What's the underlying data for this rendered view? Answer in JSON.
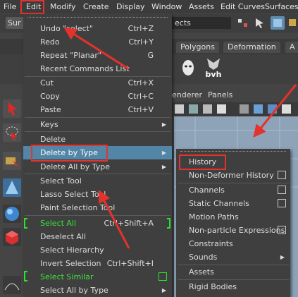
{
  "menubar": {
    "items": [
      "File",
      "Edit",
      "Modify",
      "Create",
      "Display",
      "Window",
      "Assets",
      "Edit Curves",
      "Surfaces"
    ]
  },
  "background": {
    "workspace_field": "Sur",
    "objects_field": "ects",
    "shelf_tabs": [
      "Polygons",
      "Deformation",
      "A"
    ],
    "bvh_label": "bvh",
    "panel_menu": [
      "enderer",
      "Panels"
    ]
  },
  "edit_menu": {
    "items": [
      {
        "label": "Undo \"select\"",
        "shortcut": "Ctrl+Z"
      },
      {
        "label": "Redo",
        "shortcut": "Ctrl+Y"
      },
      {
        "label": "Repeat \"Planar\"",
        "shortcut": "G"
      },
      {
        "label": "Recent Commands List",
        "shortcut": ""
      },
      {
        "label": "Cut",
        "shortcut": "Ctrl+X"
      },
      {
        "label": "Copy",
        "shortcut": "Ctrl+C"
      },
      {
        "label": "Paste",
        "shortcut": "Ctrl+V"
      },
      {
        "label": "Keys",
        "shortcut": ""
      },
      {
        "label": "Delete",
        "shortcut": ""
      },
      {
        "label": "Delete by Type",
        "shortcut": ""
      },
      {
        "label": "Delete All by Type",
        "shortcut": ""
      },
      {
        "label": "Select Tool",
        "shortcut": ""
      },
      {
        "label": "Lasso Select Tool",
        "shortcut": ""
      },
      {
        "label": "Paint Selection Tool",
        "shortcut": ""
      },
      {
        "label": "Select All",
        "shortcut": "Ctrl+Shift+A"
      },
      {
        "label": "Deselect All",
        "shortcut": ""
      },
      {
        "label": "Select Hierarchy",
        "shortcut": ""
      },
      {
        "label": "Invert Selection",
        "shortcut": "Ctrl+Shift+I"
      },
      {
        "label": "Select Similar",
        "shortcut": ""
      },
      {
        "label": "Select All by Type",
        "shortcut": ""
      }
    ]
  },
  "delete_by_type_submenu": {
    "items": [
      {
        "label": "History"
      },
      {
        "label": "Non-Deformer History"
      },
      {
        "label": "Channels"
      },
      {
        "label": "Static Channels"
      },
      {
        "label": "Motion Paths"
      },
      {
        "label": "Non-particle Expressions"
      },
      {
        "label": "Constraints"
      },
      {
        "label": "Sounds"
      },
      {
        "label": "Assets"
      },
      {
        "label": "Rigid Bodies"
      }
    ]
  },
  "colors": {
    "menu_bg": "#3f3f3f",
    "highlight": "#5285a6",
    "annotation_red": "#e4322c",
    "option_green": "#39e639"
  },
  "icons": [
    "select-arrow-icon",
    "lasso-icon",
    "paint-select-icon",
    "cone-icon",
    "sphere-icon",
    "cube-icon",
    "head-icon",
    "camera-icon"
  ]
}
